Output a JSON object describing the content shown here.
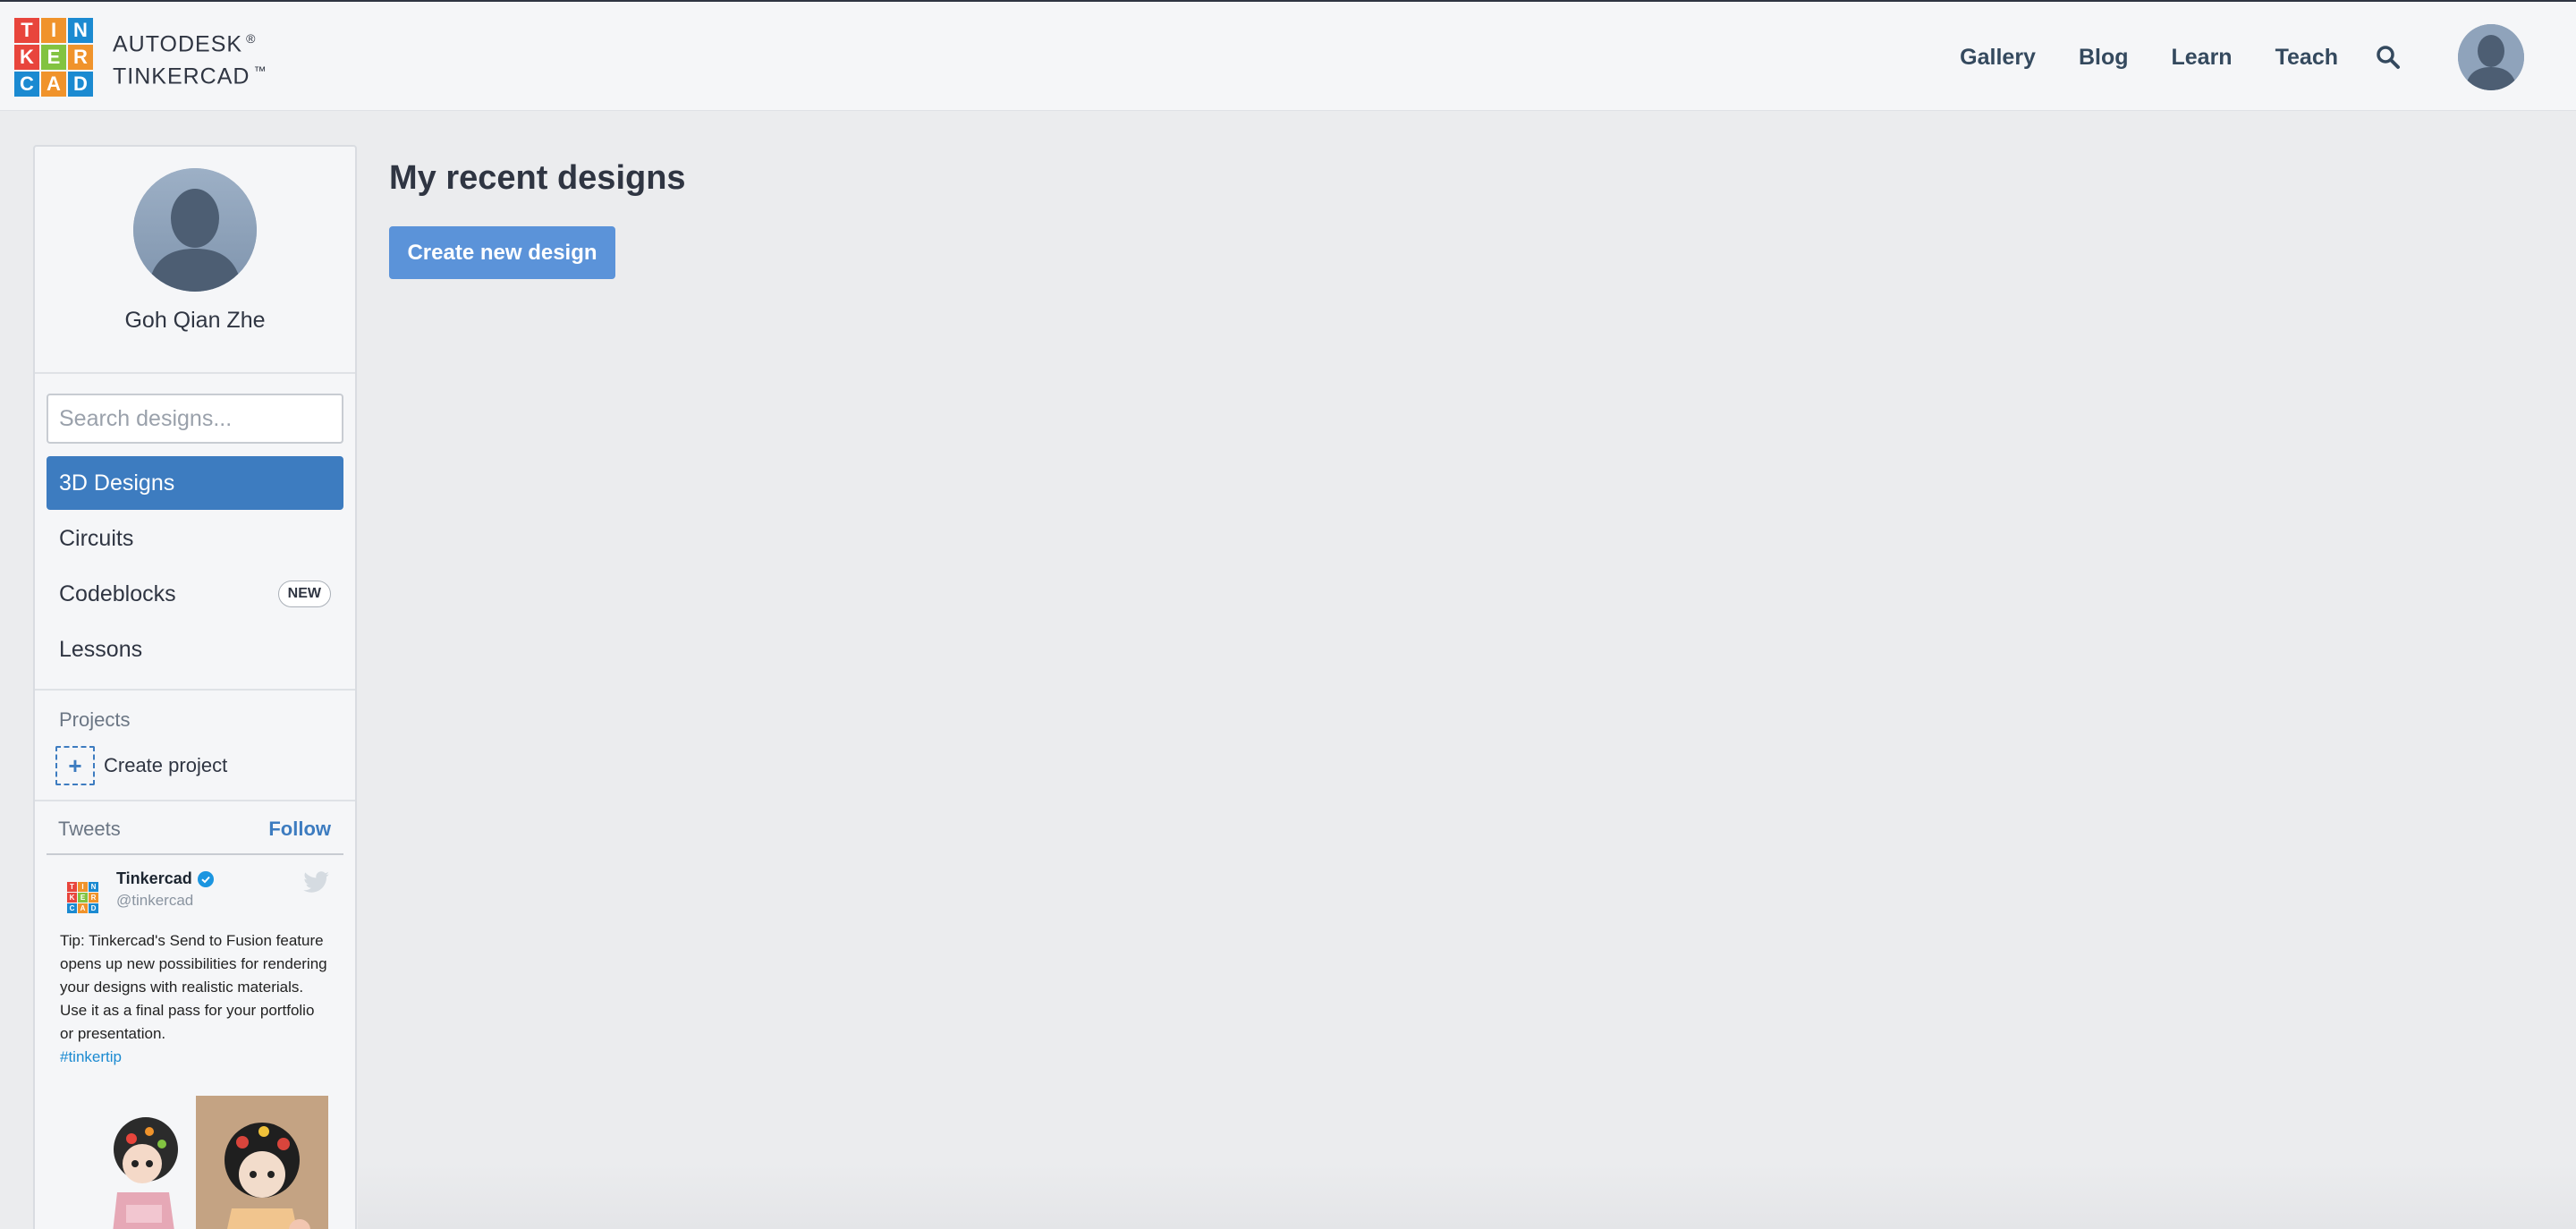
{
  "header": {
    "logo": {
      "letters": [
        "T",
        "I",
        "N",
        "K",
        "E",
        "R",
        "C",
        "A",
        "D"
      ],
      "colors": [
        "#e8453c",
        "#f0932b",
        "#1b8ad1",
        "#e8453c",
        "#82c341",
        "#f0932b",
        "#1b8ad1",
        "#f0932b",
        "#1b8ad1"
      ],
      "line1": "AUTODESK",
      "line1_mark": "®",
      "line2": "TINKERCAD",
      "line2_mark": "™"
    },
    "nav": [
      "Gallery",
      "Blog",
      "Learn",
      "Teach"
    ],
    "search_icon": "search-icon",
    "avatar_icon": "user-avatar"
  },
  "sidebar": {
    "user_name": "Goh Qian Zhe",
    "search_placeholder": "Search designs...",
    "menu": [
      {
        "label": "3D Designs",
        "active": true
      },
      {
        "label": "Circuits",
        "active": false
      },
      {
        "label": "Codeblocks",
        "active": false,
        "badge": "NEW"
      },
      {
        "label": "Lessons",
        "active": false
      }
    ],
    "projects_heading": "Projects",
    "create_project_label": "Create project",
    "tweets_heading": "Tweets",
    "follow_label": "Follow",
    "tweet": {
      "name": "Tinkercad",
      "handle": "@tinkercad",
      "text": "Tip: Tinkercad's Send to Fusion feature opens up new possibilities for rendering your designs with realistic materials. Use it as a final pass for your portfolio or presentation.",
      "hashtag": "#tinkertip"
    }
  },
  "main": {
    "title": "My recent designs",
    "create_button": "Create new design"
  },
  "colors": {
    "accent": "#3d7cc0",
    "button": "#5b93d9",
    "background": "#ebecee"
  }
}
